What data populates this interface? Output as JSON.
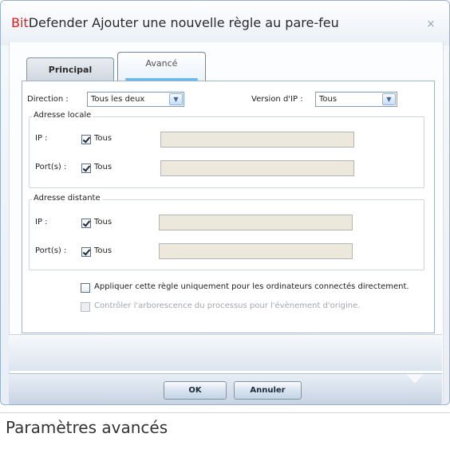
{
  "dialog": {
    "title": {
      "brand_prefix": "Bit",
      "brand_suffix": "Defender",
      "text": " Ajouter une nouvelle règle au pare-feu"
    },
    "close_glyph": "×"
  },
  "tabs": [
    {
      "label": "Principal",
      "active": false
    },
    {
      "label": "Avancé",
      "active": true
    }
  ],
  "form": {
    "direction": {
      "label": "Direction :",
      "value": "Tous les deux"
    },
    "ip_version": {
      "label": "Version d'IP :",
      "value": "Tous"
    },
    "local": {
      "title": "Adresse locale",
      "ip_label": "IP :",
      "ip_checkbox": "Tous",
      "ports_label": "Port(s) :",
      "ports_checkbox": "Tous"
    },
    "remote": {
      "title": "Adresse distante",
      "ip_label": "IP :",
      "ip_checkbox": "Tous",
      "ports_label": "Port(s) :",
      "ports_checkbox": "Tous"
    },
    "apply_direct": "Appliquer cette règle uniquement pour les ordinateurs connectés directement.",
    "control_tree": "Contrôler l'arborescence du processus pour l'évènement d'origine."
  },
  "buttons": {
    "ok": "OK",
    "cancel": "Annuler"
  },
  "icons": {
    "dropdown": "▼"
  },
  "caption": "Paramètres avancés"
}
